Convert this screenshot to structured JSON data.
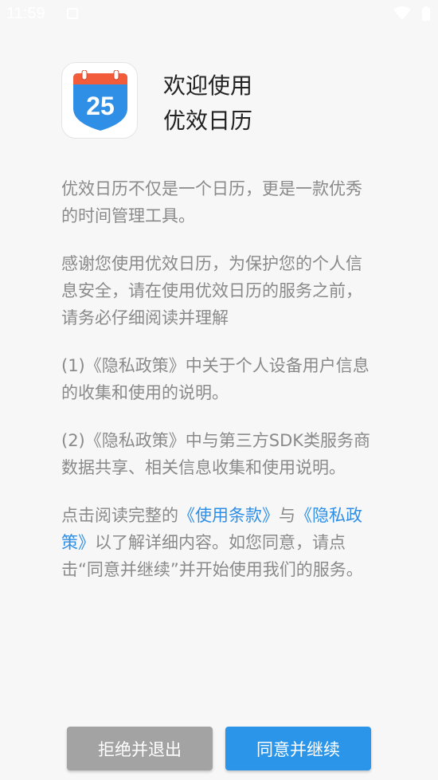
{
  "status_bar": {
    "time": "11:59",
    "icons": [
      "notification-icon",
      "wifi-icon",
      "battery-icon"
    ]
  },
  "header": {
    "icon_day": "25",
    "title_line1": "欢迎使用",
    "title_line2": "优效日历"
  },
  "body": {
    "p1": "优效日历不仅是一个日历，更是一款优秀的时间管理工具。",
    "p2": "感谢您使用优效日历，为保护您的个人信息安全，请在使用优效日历的服务之前，请务必仔细阅读并理解",
    "p3": "(1)《隐私政策》中关于个人设备用户信息的收集和使用的说明。",
    "p4": "(2)《隐私政策》中与第三方SDK类服务商数据共享、相关信息收集和使用说明。",
    "p5_prefix": "点击阅读完整的",
    "p5_link_terms": "《使用条款》",
    "p5_and": "与",
    "p5_link_privacy": "《隐私政策》",
    "p5_suffix": "以了解详细内容。如您同意，请点击“同意并继续”并开始使用我们的服务。"
  },
  "buttons": {
    "reject": "拒绝并退出",
    "agree": "同意并继续"
  },
  "colors": {
    "link": "#2f8fe6",
    "agree_button": "#2b95ea",
    "reject_button": "#a3a3a3",
    "calendar_blue": "#2f8fe6",
    "calendar_top": "#f25c3b"
  }
}
